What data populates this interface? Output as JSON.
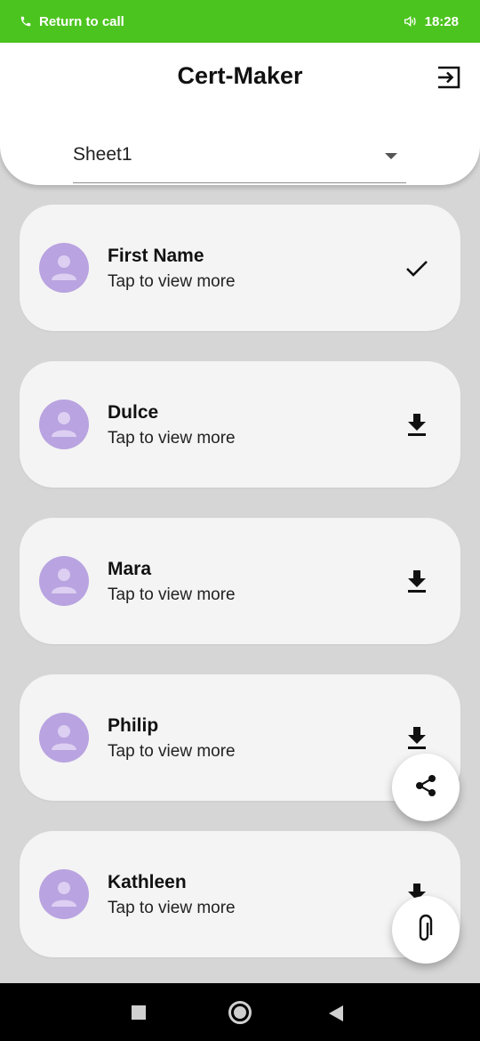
{
  "status_bar": {
    "call_label": "Return to call",
    "time": "18:28",
    "background": "#4cc41f"
  },
  "app": {
    "title": "Cert-Maker",
    "dropdown_value": "Sheet1"
  },
  "items": [
    {
      "name": "First Name",
      "subtitle": "Tap to view more",
      "action_icon": "check-icon"
    },
    {
      "name": "Dulce",
      "subtitle": "Tap to view more",
      "action_icon": "download-icon"
    },
    {
      "name": "Mara",
      "subtitle": "Tap to view more",
      "action_icon": "download-icon"
    },
    {
      "name": "Philip",
      "subtitle": "Tap to view more",
      "action_icon": "download-icon"
    },
    {
      "name": "Kathleen",
      "subtitle": "Tap to view more",
      "action_icon": "download-icon"
    }
  ],
  "fabs": {
    "share_icon": "share-icon",
    "attach_icon": "paperclip-icon"
  },
  "colors": {
    "avatar": "#b9a3e0",
    "card": "#f4f4f4",
    "background": "#d6d6d6"
  }
}
